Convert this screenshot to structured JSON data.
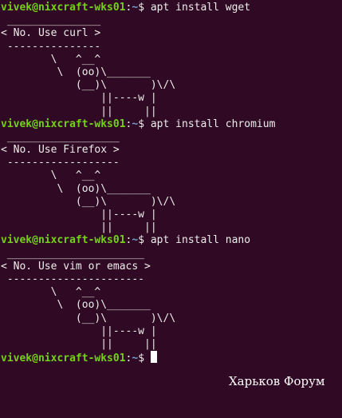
{
  "prompt": {
    "user_host": "vivek@nixcraft-wks01",
    "separator": ":",
    "path": "~",
    "symbol": "$ "
  },
  "commands": [
    {
      "command": "apt install wget",
      "output": [
        " _______________",
        "< No. Use curl >",
        " ---------------",
        "        \\   ^__^",
        "         \\  (oo)\\_______",
        "            (__)\\       )\\/\\",
        "                ||----w |",
        "                ||     ||"
      ]
    },
    {
      "command": "apt install chromium",
      "output": [
        " __________________",
        "< No. Use Firefox >",
        " ------------------",
        "        \\   ^__^",
        "         \\  (oo)\\_______",
        "            (__)\\       )\\/\\",
        "                ||----w |",
        "                ||     ||"
      ]
    },
    {
      "command": "apt install nano",
      "output": [
        " ______________________",
        "< No. Use vim or emacs >",
        " ----------------------",
        "        \\   ^__^",
        "         \\  (oo)\\_______",
        "            (__)\\       )\\/\\",
        "                ||----w |",
        "                ||     ||"
      ]
    }
  ],
  "final_prompt": {
    "command": ""
  },
  "watermark": "Харьков Форум",
  "colors": {
    "background": "#300a24",
    "user_host": "#73d216",
    "path": "#729fcf",
    "text": "#eeeeec",
    "cursor": "#ffffff"
  }
}
